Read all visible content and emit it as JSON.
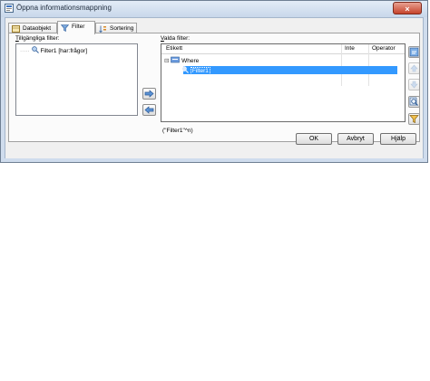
{
  "window": {
    "title": "Öppna informationsmappning",
    "close_label": "×"
  },
  "tabs": [
    {
      "label": "Dataobjekt"
    },
    {
      "label": "Filter"
    },
    {
      "label": "Sortering"
    }
  ],
  "available": {
    "label_prefix": "T",
    "label_rest": "illgängliga filter:",
    "items": [
      "Filter1 [har:frågor]"
    ]
  },
  "selected": {
    "label_prefix": "V",
    "label_rest": "alda filter:",
    "columns": [
      "Etikett",
      "Inte",
      "Operator"
    ],
    "tree": [
      {
        "toggle": "⊟",
        "label": "Where"
      },
      {
        "label": "Filter1"
      }
    ],
    "expression": "(\"Filter1\"^n)"
  },
  "buttons": {
    "ok": "OK",
    "cancel": "Avbryt",
    "help": "Hjälp"
  },
  "icons": {
    "add": "arrow-right-icon",
    "remove": "arrow-left-icon",
    "side": [
      "properties-icon",
      "move-up-icon",
      "move-down-icon",
      "zoom-icon",
      "filter-icon"
    ]
  },
  "colors": {
    "selection": "#3399ff",
    "titlebar": "#c8d7ea"
  }
}
